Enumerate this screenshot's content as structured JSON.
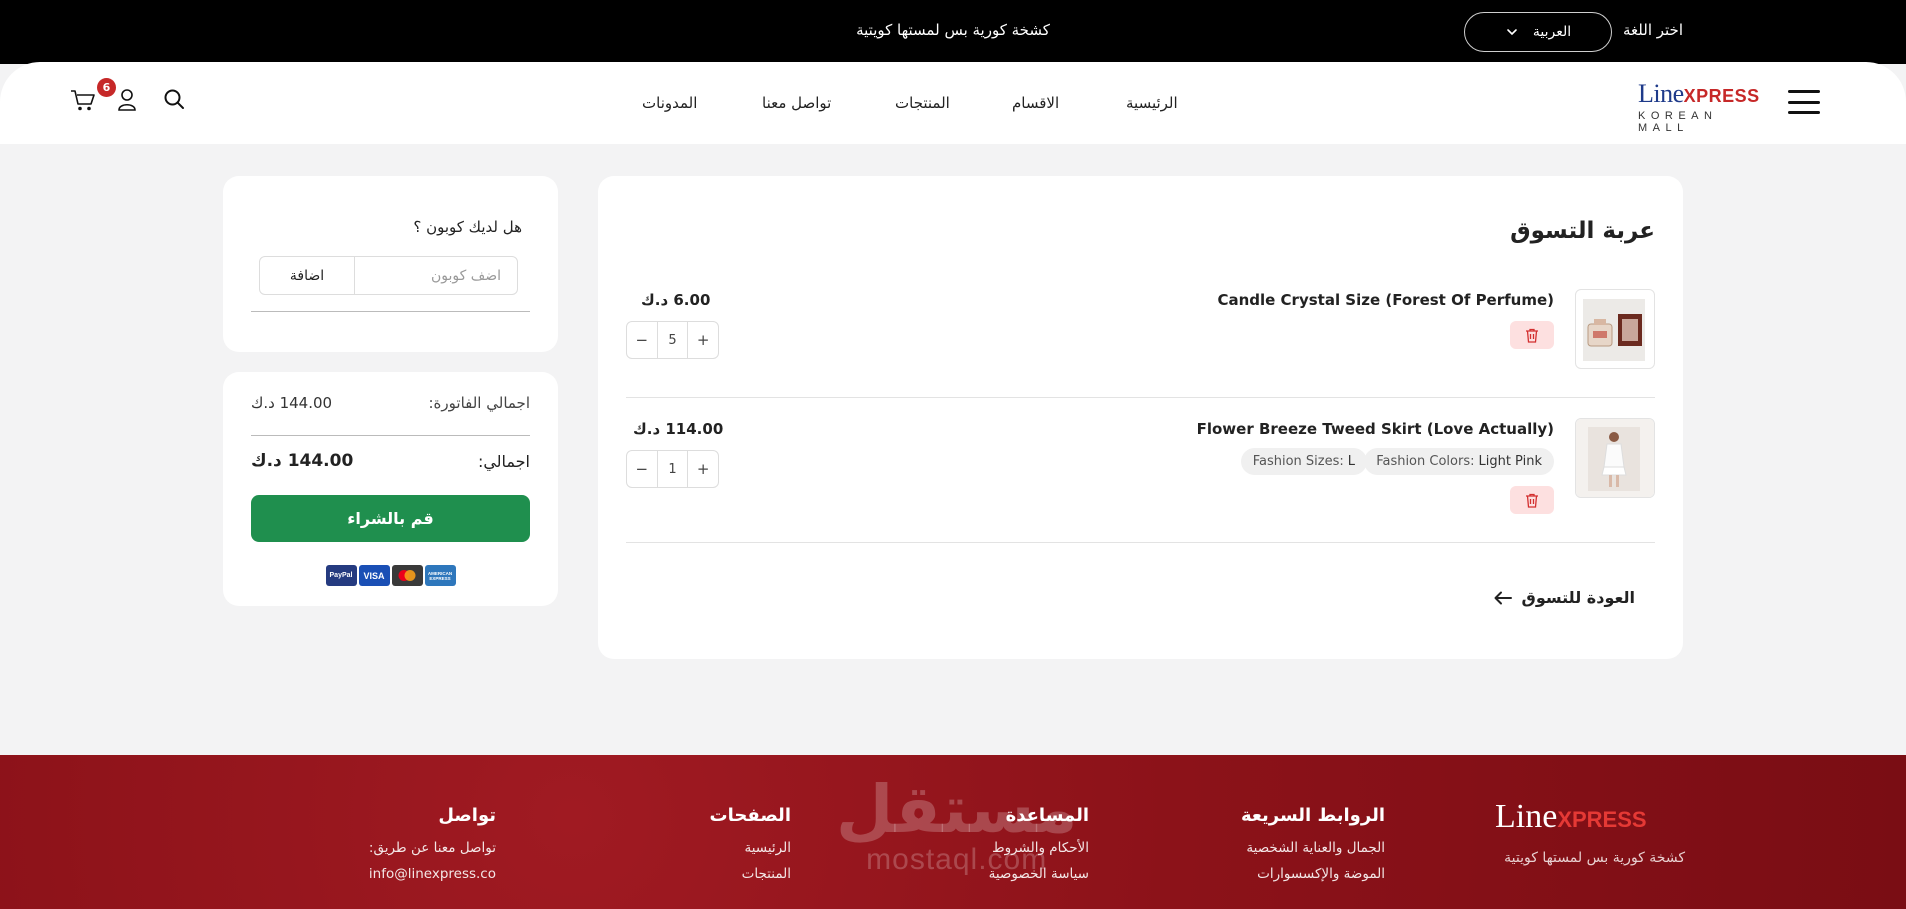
{
  "topbar": {
    "promo": "كشخة كورية بس لمستها كويتية",
    "language_label": "اختر اللغة",
    "language_value": "العربية"
  },
  "header": {
    "logo": {
      "line": "Line",
      "xpress": "XPRESS",
      "sub": "KOREAN MALL"
    },
    "nav": [
      "الرئيسية",
      "الاقسام",
      "المنتجات",
      "تواصل معنا",
      "المدونات"
    ],
    "cart_count": "6"
  },
  "cart": {
    "title": "عربة التسوق",
    "items": [
      {
        "name": "Candle Crystal Size (Forest Of Perfume)",
        "price": "6.00 د.ك",
        "quantity": "5"
      },
      {
        "name": "Flower Breeze Tweed Skirt (Love Actually)",
        "price": "114.00 د.ك",
        "quantity": "1",
        "options": [
          {
            "label": "Fashion Colors:",
            "value": "Light Pink"
          },
          {
            "label": "Fashion Sizes:",
            "value": "L"
          }
        ]
      }
    ],
    "back_link": "العودة للتسوق",
    "stepper_minus": "−",
    "stepper_plus": "+"
  },
  "coupon": {
    "question": "هل لديك كوبون ؟",
    "placeholder": "اضف كوبون",
    "button": "اضافة"
  },
  "totals": {
    "invoice_label": "اجمالي الفاتورة:",
    "invoice_value": "144.00 د.ك",
    "total_label": "اجمالي:",
    "total_value": "144.00 د.ك",
    "buy_button": "قم بالشراء",
    "payments": [
      "PayPal",
      "VISA",
      "",
      "AMERICAN EXPRESS"
    ]
  },
  "footer": {
    "logo": {
      "line": "Line",
      "xpress": "XPRESS"
    },
    "tagline": "كشخة كورية بس لمستها كويتية",
    "columns": [
      {
        "heading": "الروابط السريعة",
        "links": [
          "الجمال والعناية الشخصية",
          "الموضة والإكسسوارات"
        ]
      },
      {
        "heading": "المساعدة",
        "links": [
          "الأحكام والشروط",
          "سياسة الخصوصية"
        ]
      },
      {
        "heading": "الصفحات",
        "links": [
          "الرئيسية",
          "المنتجات"
        ]
      },
      {
        "heading": "تواصل",
        "links": [
          "تواصل معنا عن طريق:",
          "info@linexpress.co"
        ]
      }
    ],
    "watermark": {
      "ar": "مستقل",
      "en": "mostaql.com"
    }
  },
  "colors": {
    "accent_green": "#1f8f4e",
    "brand_red": "#c62828",
    "footer_red": "#8c1219"
  }
}
